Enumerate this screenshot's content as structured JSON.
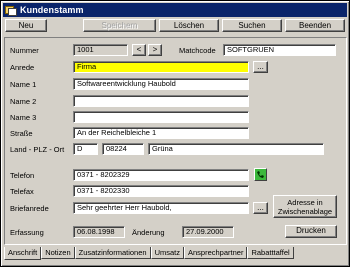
{
  "window": {
    "title": "Kundenstamm"
  },
  "toolbar": {
    "new_label": "Neu",
    "save_label": "Speichern",
    "delete_label": "Löschen",
    "search_label": "Suchen",
    "exit_label": "Beenden"
  },
  "form": {
    "number_label": "Nummer",
    "number_value": "1001",
    "prev_label": "<",
    "next_label": ">",
    "matchcode_label": "Matchcode",
    "matchcode_value": "SOFTGRUEN",
    "salutation_label": "Anrede",
    "salutation_value": "Firma",
    "picker_label": "...",
    "name1_label": "Name 1",
    "name1_value": "Softwareentwicklung Haubold",
    "name2_label": "Name 2",
    "name2_value": "",
    "name3_label": "Name 3",
    "name3_value": "",
    "street_label": "Straße",
    "street_value": "An der Reichelbleiche 1",
    "location_label": "Land - PLZ - Ort",
    "country_value": "D",
    "zip_value": "08224",
    "city_value": "Grüna",
    "phone_label": "Telefon",
    "phone_value": "0371 - 8202329",
    "fax_label": "Telefax",
    "fax_value": "0371 - 8202330",
    "letter_salutation_label": "Briefanrede",
    "letter_salutation_value": "Sehr geehrter Herr Haubold,",
    "clipboard_button_line1": "Adresse in",
    "clipboard_button_line2": "Zwischenablage",
    "created_label": "Erfassung",
    "created_value": "06.08.1998",
    "modified_label": "Änderung",
    "modified_value": "27.09.2000",
    "print_label": "Drucken"
  },
  "tabs": [
    "Anschrift",
    "Notizen",
    "Zusatzinformationen",
    "Umsatz",
    "Ansprechpartner",
    "Rabatttaffel"
  ],
  "colors": {
    "title_bar": "#0a246a",
    "highlight_field": "#ffff00",
    "dial_button": "#3cb83c"
  }
}
